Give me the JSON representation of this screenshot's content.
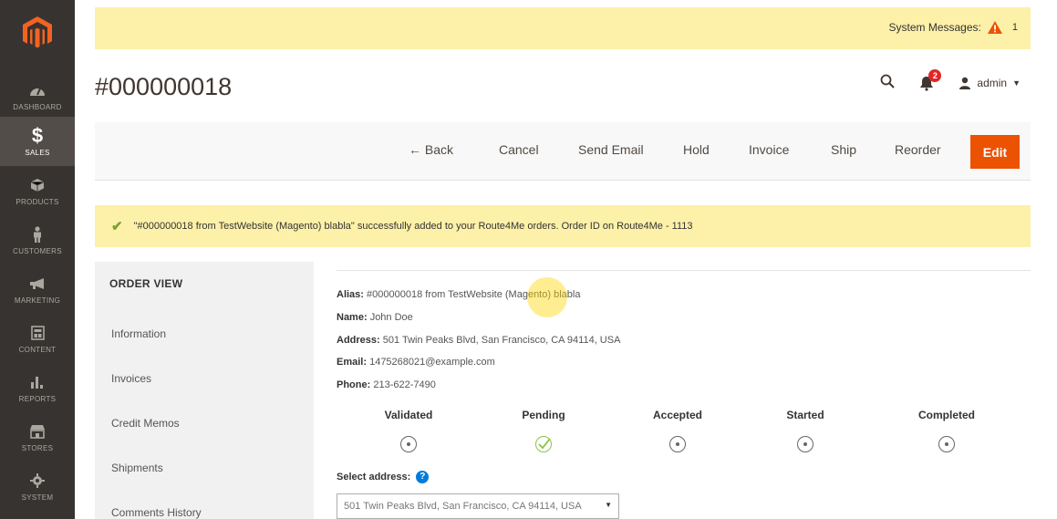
{
  "header": {
    "page_title": "#000000018",
    "user": "admin",
    "notification_count": "2"
  },
  "system_messages": {
    "label": "System Messages:",
    "count": "1"
  },
  "sidebar": {
    "items": [
      {
        "label": "DASHBOARD",
        "icon": "dashboard-icon"
      },
      {
        "label": "SALES",
        "icon": "dollar-icon"
      },
      {
        "label": "PRODUCTS",
        "icon": "cube-icon"
      },
      {
        "label": "CUSTOMERS",
        "icon": "person-icon"
      },
      {
        "label": "MARKETING",
        "icon": "megaphone-icon"
      },
      {
        "label": "CONTENT",
        "icon": "content-icon"
      },
      {
        "label": "REPORTS",
        "icon": "bar-chart-icon"
      },
      {
        "label": "STORES",
        "icon": "store-icon"
      },
      {
        "label": "SYSTEM",
        "icon": "gear-icon"
      }
    ]
  },
  "toolbar": {
    "back": "← Back",
    "cancel": "Cancel",
    "send_email": "Send Email",
    "hold": "Hold",
    "invoice": "Invoice",
    "ship": "Ship",
    "reorder": "Reorder",
    "edit": "Edit"
  },
  "success_message": "\"#000000018 from TestWebsite (Magento) blabla\" successfully added to your Route4Me orders. Order ID on Route4Me - 1113",
  "order_view": {
    "title": "ORDER VIEW",
    "items": [
      "Information",
      "Invoices",
      "Credit Memos",
      "Shipments",
      "Comments History"
    ]
  },
  "details": {
    "alias_label": "Alias:",
    "alias_value": "#000000018 from TestWebsite (Magento) blabla",
    "name_label": "Name:",
    "name_value": "John Doe",
    "address_label": "Address:",
    "address_value": "501 Twin Peaks Blvd, San Francisco, CA 94114, USA",
    "email_label": "Email:",
    "email_value": "1475268021@example.com",
    "phone_label": "Phone:",
    "phone_value": "213-622-7490"
  },
  "statuses": [
    {
      "label": "Validated",
      "state": "dot"
    },
    {
      "label": "Pending",
      "state": "check"
    },
    {
      "label": "Accepted",
      "state": "dot"
    },
    {
      "label": "Started",
      "state": "dot"
    },
    {
      "label": "Completed",
      "state": "dot"
    }
  ],
  "select_address": {
    "label": "Select address:",
    "value": "501 Twin Peaks Blvd, San Francisco, CA 94114, USA"
  },
  "colors": {
    "sidebar": "#373330",
    "accent": "#eb5202",
    "message_bg": "#fdf0a8",
    "success_check": "#79a22e"
  }
}
